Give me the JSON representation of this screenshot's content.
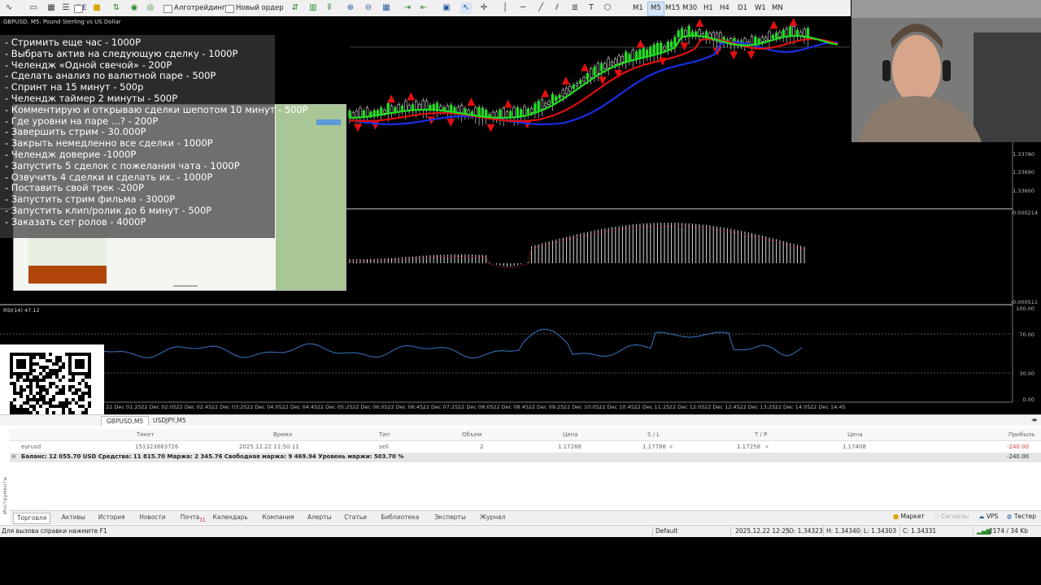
{
  "toolbar": {
    "algotrading_label": "Алготрейдинг",
    "new_order_label": "Новый ордер",
    "ide_label": "IDE",
    "timeframes": [
      "M1",
      "M5",
      "M15",
      "M30",
      "H1",
      "H4",
      "D1",
      "W1",
      "MN"
    ],
    "active_timeframe": "M5"
  },
  "chart": {
    "title": "GBPUSD, M5:  Pound Sterling vs US Dollar",
    "price_labels": [
      "1.33780",
      "1.33690",
      "1.33600"
    ],
    "macd_labels": [
      "0.000214",
      "-0.000511"
    ],
    "rsi_title": "RSI(14) 47.12",
    "rsi_labels": [
      "100.00",
      "70.00",
      "30.00",
      "0.00"
    ],
    "time_labels": [
      "22 Dec 01:25",
      "22 Dec 02:05",
      "22 Dec 02:45",
      "22 Dec 03:25",
      "22 Dec 04:05",
      "22 Dec 04:45",
      "22 Dec 05:25",
      "22 Dec 06:05",
      "22 Dec 06:45",
      "22 Dec 07:25",
      "22 Dec 08:05",
      "22 Dec 08:45",
      "22 Dec 09:25",
      "22 Dec 10:05",
      "22 Dec 10:45",
      "22 Dec 11:25",
      "22 Dec 12:05",
      "22 Dec 12:45",
      "22 Dec 13:25",
      "22 Dec 14:05",
      "22 Dec 14:45"
    ],
    "colors": {
      "ma_fast": "#22dd22",
      "ma_mid": "#e01010",
      "ma_slow": "#1a2ee8",
      "rsi": "#3a78c8",
      "up_arrow": "#e01010"
    }
  },
  "overlay_list": [
    "Стримить еще час - 1000Р",
    "Выбрать актив на следующую сделку - 1000Р",
    "Челендж «Одной свечой» - 200Р",
    "Сделать анализ по валютной паре - 500Р",
    "Спринт на 15 минут - 500р",
    "Челендж таймер 2 минуты - 500Р",
    "Комментирую и открываю сделки шепотом 10 минут - 500Р",
    "Где уровни на паре ...?  - 200Р",
    "Завершить стрим - 30.000Р",
    "Закрыть немедленно все сделки - 1000Р",
    "Челендж доверие -1000Р",
    "Запустить 5 сделок с пожелания чата - 1000Р",
    "Озвучить 4 сделки и сделать их. - 1000Р",
    "Поставить свой трек -200Р",
    "Запустить стрим фильма - 3000Р",
    "Запустить клип/ролик до 6 минут - 500Р",
    "Заказать сет ролов - 4000Р"
  ],
  "symbol_tabs": [
    "GBPUSD,M5",
    "USDJPY,M5"
  ],
  "terminal": {
    "headers": [
      "Тикет",
      "Время",
      "Тип",
      "Объем",
      "Цена",
      "S / L",
      "T / P",
      "Цена",
      "Прибыль"
    ],
    "row": {
      "symbol": "eurusd",
      "ticket": "151323883726",
      "time": "2025.12.22 11:50:11",
      "type": "sell",
      "volume": "2",
      "open_price": "1.17288",
      "sl": "1.17788",
      "tp": "1.17258",
      "price": "1.17408",
      "profit": "-240.00"
    },
    "balance_text": "Баланс: 12 055.70 USD  Средства: 11 815.70  Маржа: 2 345.76  Свободная маржа: 9 469.94  Уровень маржи: 503.70 %",
    "balance_profit": "-240.00",
    "side_label": "Инструменты"
  },
  "bottom_tabs": [
    {
      "label": "Торговля",
      "badge": ""
    },
    {
      "label": "Активы",
      "badge": ""
    },
    {
      "label": "История",
      "badge": ""
    },
    {
      "label": "Новости",
      "badge": ""
    },
    {
      "label": "Почта",
      "badge": "11"
    },
    {
      "label": "Календарь",
      "badge": ""
    },
    {
      "label": "Компания",
      "badge": ""
    },
    {
      "label": "Алерты",
      "badge": ""
    },
    {
      "label": "Статьи",
      "badge": ""
    },
    {
      "label": "Библиотека",
      "badge": ""
    },
    {
      "label": "Эксперты",
      "badge": ""
    },
    {
      "label": "Журнал",
      "badge": ""
    }
  ],
  "right_tabs": {
    "market": "Маркет",
    "signals": "Сигналы",
    "vps": "VPS",
    "tester": "Тестер"
  },
  "statusbar": {
    "help": "Для вызова справки нажмите F1",
    "profile": "Default",
    "datetime": "2025.12.22 12:25",
    "open": "O: 1.34323",
    "high": "H: 1.34340",
    "low": "L: 1.34303",
    "close": "C: 1.34331",
    "traffic": "2174 / 34 Kb"
  }
}
